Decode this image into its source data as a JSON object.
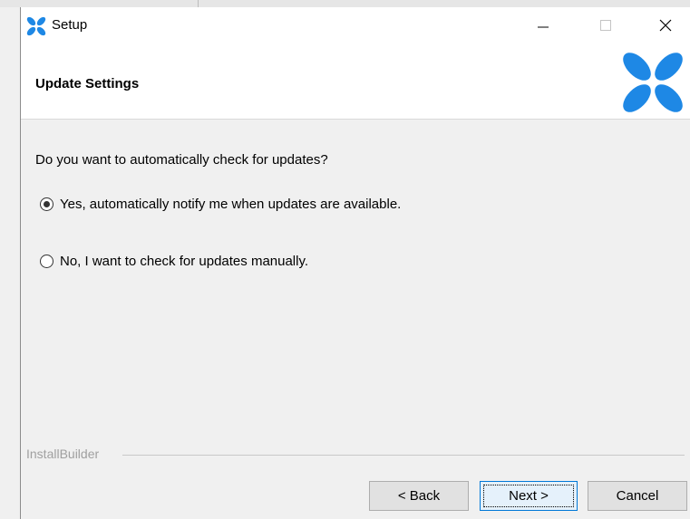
{
  "window": {
    "title": "Setup",
    "logo_icon": "blue-x-logo-icon",
    "controls": {
      "minimize_icon": "minimize-icon",
      "maximize_icon": "maximize-icon",
      "close_icon": "close-icon"
    }
  },
  "header": {
    "title": "Update Settings",
    "logo_icon": "blue-x-logo-icon"
  },
  "main": {
    "question": "Do you want to automatically check for updates?",
    "options": [
      {
        "label": "Yes, automatically notify me when updates are available.",
        "selected": true
      },
      {
        "label": "No, I want to check for updates manually.",
        "selected": false
      }
    ]
  },
  "footer": {
    "brand": "InstallBuilder",
    "buttons": {
      "back": "< Back",
      "next": "Next >",
      "cancel": "Cancel"
    }
  },
  "colors": {
    "logo_blue": "#1e88e5",
    "window_bg": "#f0f0f0",
    "titlebar_bg": "#ffffff",
    "focus_border": "#0078d7"
  }
}
